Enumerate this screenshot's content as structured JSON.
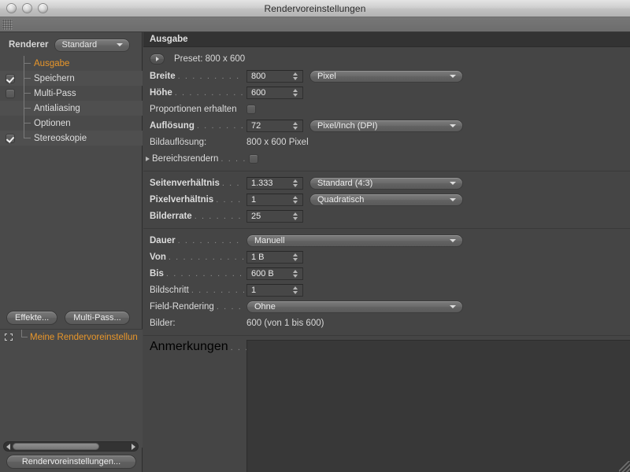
{
  "window": {
    "title": "Rendervoreinstellungen",
    "traffic_lights": [
      "close",
      "minimize",
      "zoom"
    ]
  },
  "sidebar": {
    "renderer_label": "Renderer",
    "renderer_value": "Standard",
    "tree_items": [
      {
        "label": "Ausgabe",
        "checkbox": "none",
        "active": true
      },
      {
        "label": "Speichern",
        "checkbox": "checked",
        "active": false
      },
      {
        "label": "Multi-Pass",
        "checkbox": "unchecked",
        "active": false
      },
      {
        "label": "Antialiasing",
        "checkbox": "none",
        "active": false
      },
      {
        "label": "Optionen",
        "checkbox": "none",
        "active": false
      },
      {
        "label": "Stereoskopie",
        "checkbox": "checked",
        "active": false
      }
    ],
    "buttons": {
      "effects": "Effekte...",
      "multipass": "Multi-Pass..."
    },
    "preset_item": "Meine Rendervoreinstellun",
    "bottom_button": "Rendervoreinstellungen..."
  },
  "main": {
    "section_title": "Ausgabe",
    "preset_text": "Preset: 800 x 600",
    "group1": [
      {
        "label": "Breite",
        "bold": true,
        "dots": ". . . . . . . . . . . . .",
        "value": "800",
        "unit": "Pixel"
      },
      {
        "label": "Höhe",
        "bold": true,
        "dots": ". . . . . . . . . . . . .",
        "value": "600",
        "unit": ""
      }
    ],
    "keep_proportions_label": "Proportionen erhalten",
    "resolution": {
      "label": "Auflösung",
      "dots": ". . . . . . . . .",
      "value": "72",
      "unit": "Pixel/Inch (DPI)"
    },
    "image_resolution_label": "Bildauflösung:",
    "image_resolution_value": "800 x 600 Pixel",
    "region_render_label": "Bereichsrendern",
    "region_render_dots": ". . . . .",
    "group2": [
      {
        "label": "Seitenverhältnis",
        "dots": ". . . .",
        "value": "1.333",
        "unit": "Standard (4:3)"
      },
      {
        "label": "Pixelverhältnis",
        "dots": ". . . . .",
        "value": "1",
        "unit": "Quadratisch"
      },
      {
        "label": "Bilderrate",
        "dots": ". . . . . . . . .",
        "value": "25",
        "unit": ""
      }
    ],
    "group3": {
      "duration": {
        "label": "Dauer",
        "dots": ". . . . . . . . . . . .",
        "value": "Manuell"
      },
      "from": {
        "label": "Von",
        "dots": ". . . . . . . . . . . . .",
        "value": "1 B"
      },
      "to": {
        "label": "Bis",
        "dots": ". . . . . . . . . . . . .",
        "value": "600 B"
      },
      "step": {
        "label": "Bildschritt",
        "dots": ". . . . . . . .",
        "value": "1"
      },
      "field_rendering": {
        "label": "Field-Rendering",
        "dots": ". . . . .",
        "value": "Ohne"
      },
      "frames_label": "Bilder:",
      "frames_value": "600 (von 1 bis 600)"
    },
    "notes": {
      "label": "Anmerkungen",
      "dots": ". . . . . . .",
      "value": ""
    }
  },
  "colors": {
    "accent_orange": "#e8962a",
    "panel_bg": "#454545",
    "sidebar_bg": "#4a4a4a",
    "header_bg": "#333333",
    "field_bg": "#474747"
  }
}
